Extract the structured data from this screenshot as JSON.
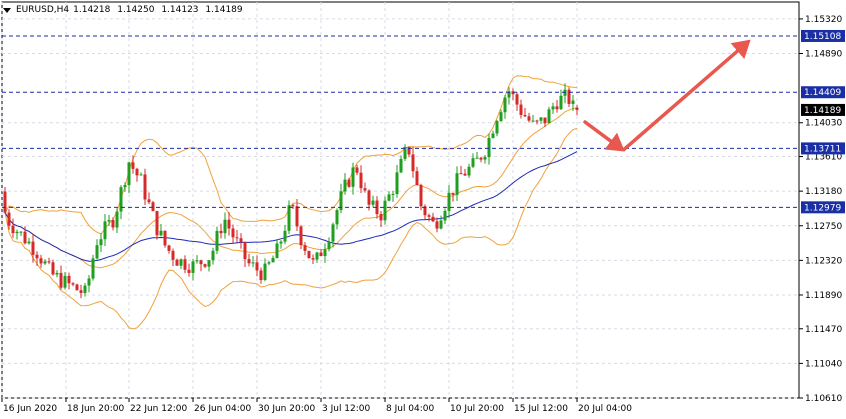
{
  "header": {
    "symbol": "EURUSD,H4",
    "open": "1.14218",
    "high": "1.14250",
    "low": "1.14123",
    "close": "1.14189"
  },
  "colors": {
    "background": "#ffffff",
    "bull": "#1f9e1f",
    "bear": "#d42a2a",
    "bollinger": "#f0a23c",
    "ma": "#1c2ab8",
    "level_line": "#1a2fa5",
    "label_bg": "#1a2fa5",
    "price_label_bg": "#000000",
    "arrow": "#e8584e",
    "grid": "#d7dbe6"
  },
  "price_axis": {
    "ticks": [
      "1.15320",
      "1.14890",
      "1.14030",
      "1.13610",
      "1.13180",
      "1.12750",
      "1.12320",
      "1.11890",
      "1.11470",
      "1.11040",
      "1.10610"
    ]
  },
  "time_axis": {
    "ticks": [
      "16 Jun 2020",
      "18 Jun 20:00",
      "22 Jun 12:00",
      "26 Jun 04:00",
      "30 Jun 20:00",
      "3 Jul 12:00",
      "8 Jul 04:00",
      "10 Jul 20:00",
      "15 Jul 12:00",
      "20 Jul 04:00"
    ]
  },
  "levels": [
    {
      "label": "1.15108",
      "price": 1.15108
    },
    {
      "label": "1.14409",
      "price": 1.14409
    },
    {
      "label": "1.13711",
      "price": 1.13711
    },
    {
      "label": "1.12979",
      "price": 1.12979
    }
  ],
  "current_price": {
    "label": "1.14189",
    "price": 1.14189
  },
  "chart_data": {
    "type": "candlestick",
    "symbol": "EURUSD",
    "timeframe": "H4",
    "x_start": "16 Jun 2020",
    "x_end": "20 Jul 04:00",
    "ylim": [
      1.1061,
      1.1553
    ],
    "indicators": [
      "Bollinger Bands",
      "Moving Average"
    ],
    "forecast": "drop to 1.13711 then rise to 1.15108"
  }
}
